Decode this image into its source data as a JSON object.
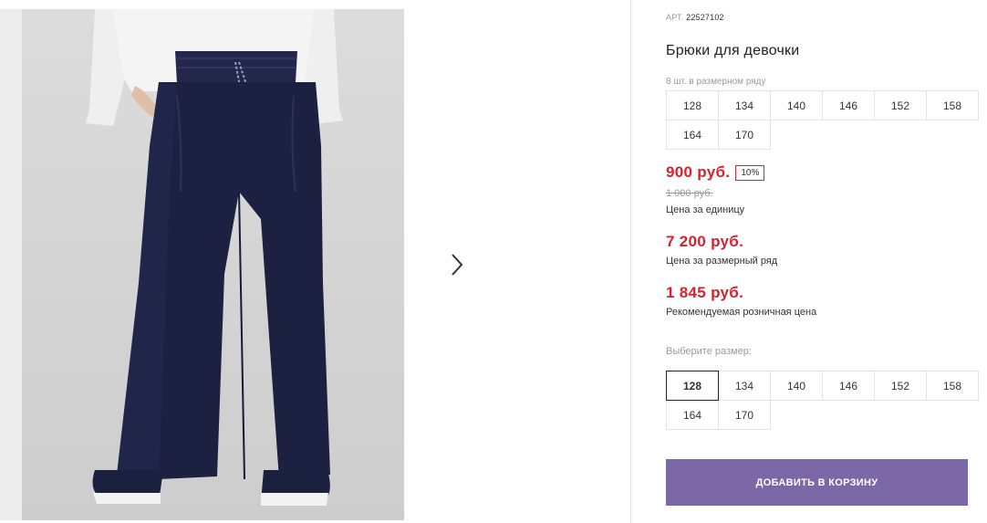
{
  "product": {
    "article_label": "АРТ.",
    "article_number": "22527102",
    "title": "Брюки для девочки",
    "range_note": "8 шт. в размерном ряду",
    "range_sizes": [
      "128",
      "134",
      "140",
      "146",
      "152",
      "158",
      "164",
      "170"
    ]
  },
  "pricing": {
    "unit_price": "900 руб.",
    "discount": "10%",
    "old_price": "1 000 руб.",
    "unit_caption": "Цена за единицу",
    "range_price": "7 200 руб.",
    "range_caption": "Цена за размерный ряд",
    "retail_price": "1 845 руб.",
    "retail_caption": "Рекомендуемая розничная цена"
  },
  "size_selector": {
    "label": "Выберите размер:",
    "selected": "128",
    "options": [
      "128",
      "134",
      "140",
      "146",
      "152",
      "158",
      "164",
      "170"
    ]
  },
  "actions": {
    "add_to_cart": "ДОБАВИТЬ В КОРЗИНУ"
  },
  "gallery": {
    "next_icon": "chevron-right-icon"
  },
  "colors": {
    "accent_red": "#d9202f",
    "button_purple": "#7b67a6",
    "pants_navy": "#1c2142"
  }
}
